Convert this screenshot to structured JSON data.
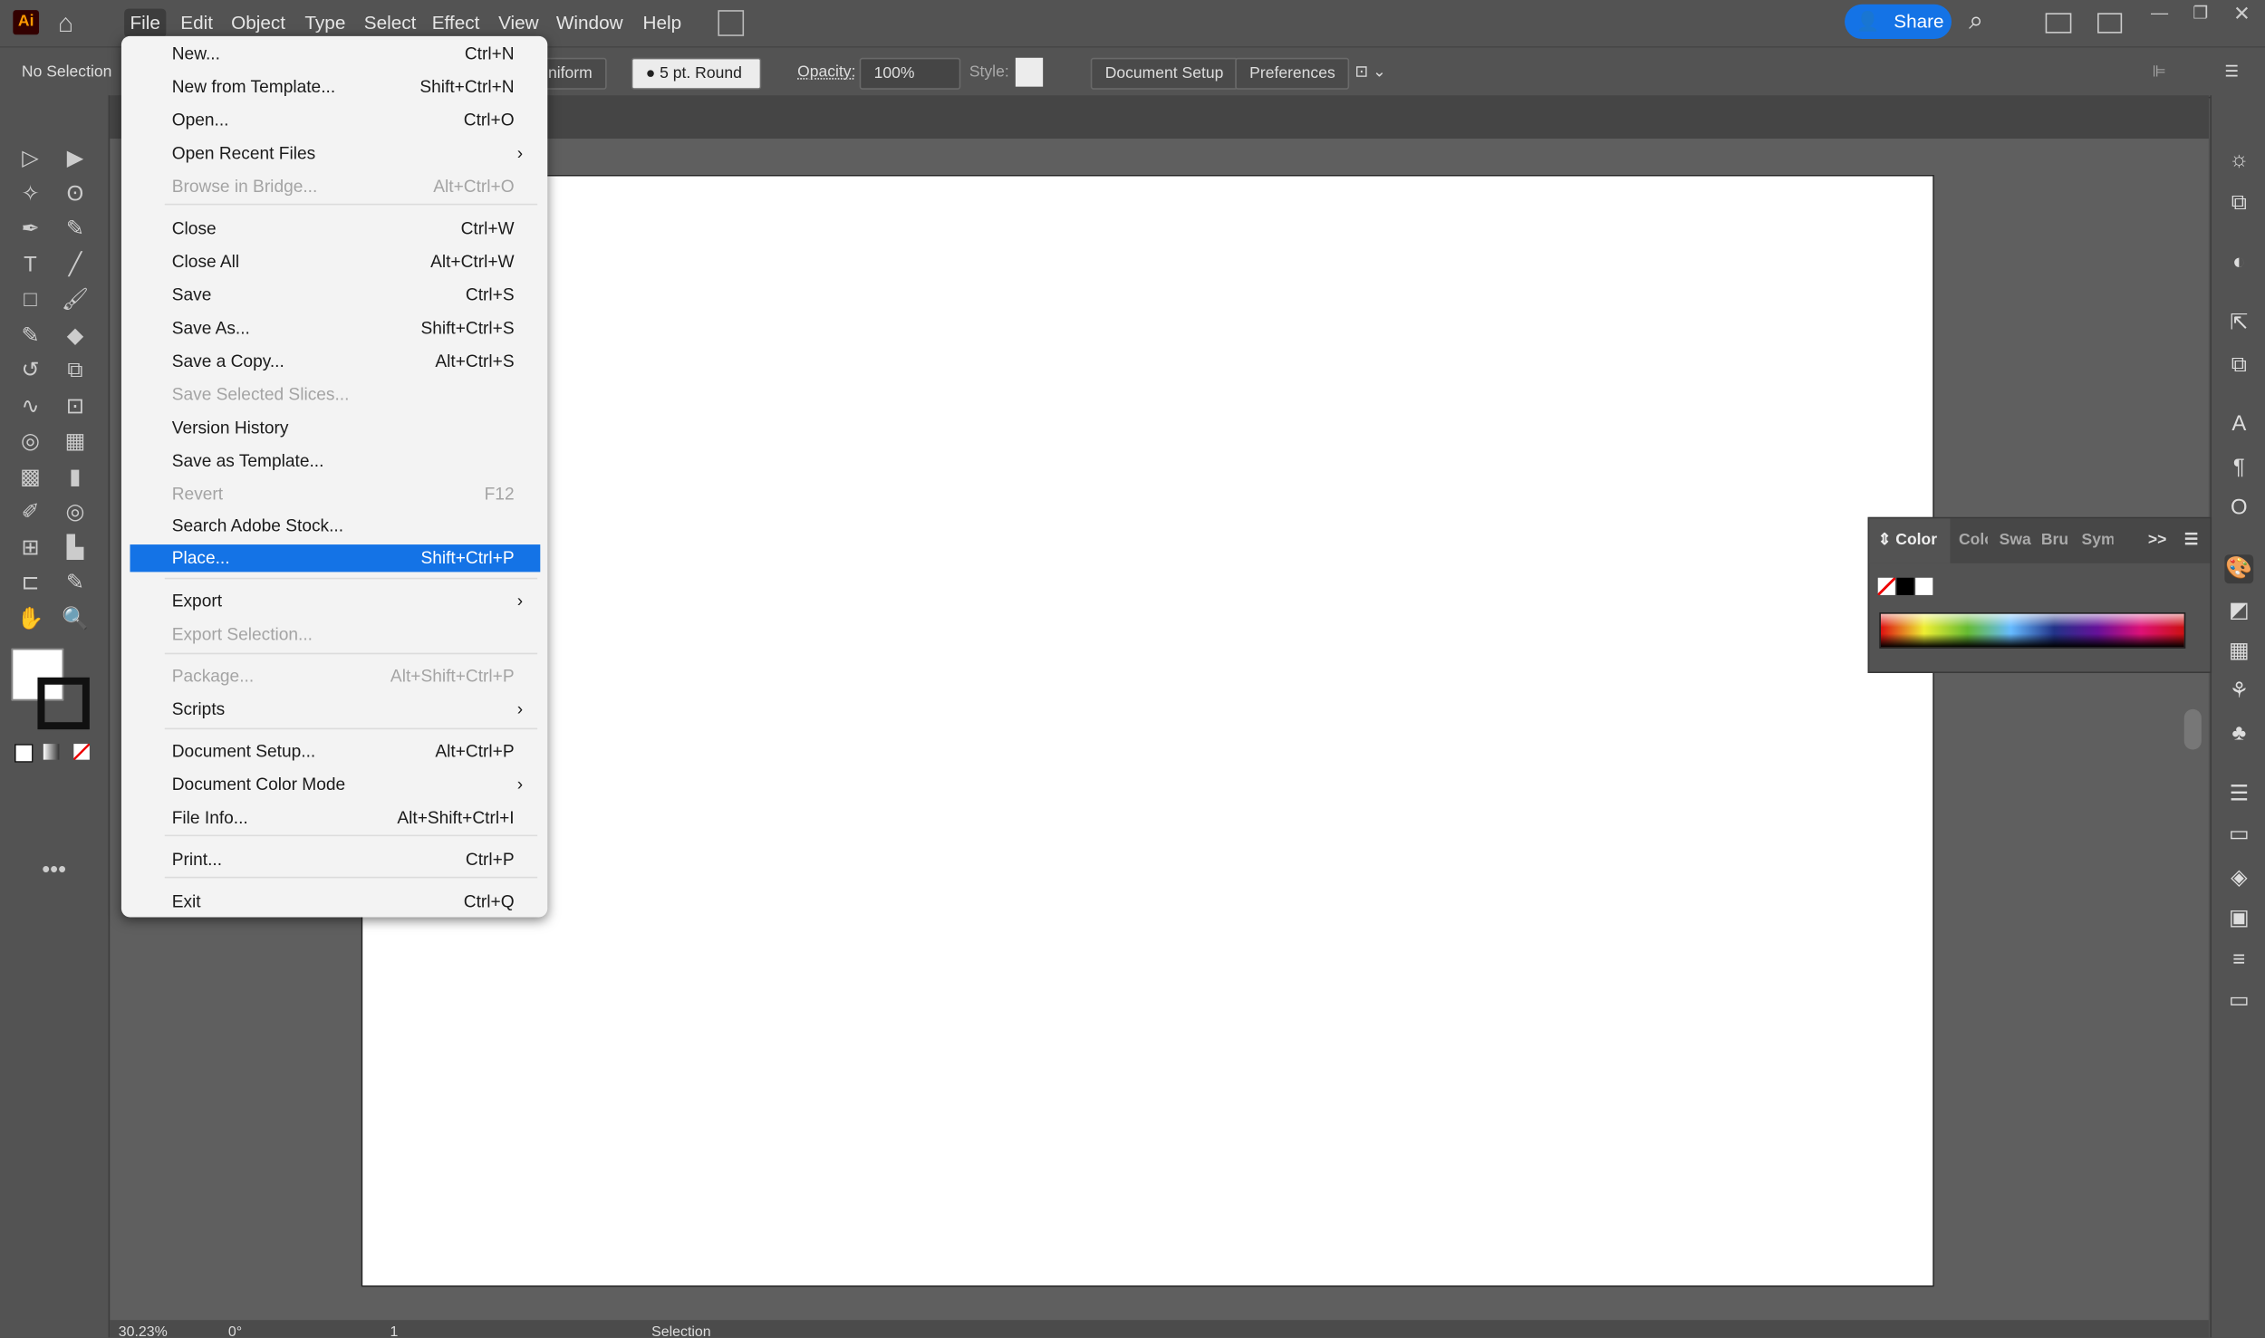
{
  "app": {
    "logo": "Ai",
    "share_label": "Share"
  },
  "menubar": [
    "File",
    "Edit",
    "Object",
    "Type",
    "Select",
    "Effect",
    "View",
    "Window",
    "Help"
  ],
  "control_bar": {
    "selection": "No Selection",
    "stroke_profile": "Uniform",
    "brush": "5 pt. Round",
    "opacity_label": "Opacity:",
    "opacity": "100%",
    "style_label": "Style:",
    "document_setup": "Document Setup",
    "preferences": "Preferences"
  },
  "file_menu": [
    {
      "label": "New...",
      "shortcut": "Ctrl+N"
    },
    {
      "label": "New from Template...",
      "shortcut": "Shift+Ctrl+N"
    },
    {
      "label": "Open...",
      "shortcut": "Ctrl+O"
    },
    {
      "label": "Open Recent Files",
      "submenu": true
    },
    {
      "label": "Browse in Bridge...",
      "shortcut": "Alt+Ctrl+O",
      "disabled": true
    },
    {
      "label": "Close",
      "shortcut": "Ctrl+W"
    },
    {
      "label": "Close All",
      "shortcut": "Alt+Ctrl+W"
    },
    {
      "label": "Save",
      "shortcut": "Ctrl+S"
    },
    {
      "label": "Save As...",
      "shortcut": "Shift+Ctrl+S"
    },
    {
      "label": "Save a Copy...",
      "shortcut": "Alt+Ctrl+S"
    },
    {
      "label": "Save Selected Slices...",
      "disabled": true
    },
    {
      "label": "Version History"
    },
    {
      "label": "Save as Template..."
    },
    {
      "label": "Revert",
      "shortcut": "F12",
      "disabled": true
    },
    {
      "label": "Search Adobe Stock..."
    },
    {
      "label": "Place...",
      "shortcut": "Shift+Ctrl+P",
      "selected": true
    },
    {
      "label": "Export",
      "submenu": true
    },
    {
      "label": "Export Selection...",
      "disabled": true
    },
    {
      "label": "Package...",
      "shortcut": "Alt+Shift+Ctrl+P",
      "disabled": true
    },
    {
      "label": "Scripts",
      "submenu": true
    },
    {
      "label": "Document Setup...",
      "shortcut": "Alt+Ctrl+P"
    },
    {
      "label": "Document Color Mode",
      "submenu": true
    },
    {
      "label": "File Info...",
      "shortcut": "Alt+Shift+Ctrl+I"
    },
    {
      "label": "Print...",
      "shortcut": "Ctrl+P"
    },
    {
      "label": "Exit",
      "shortcut": "Ctrl+Q"
    }
  ],
  "color_panel": {
    "tabs": [
      "Color",
      "Colo",
      "Swa",
      "Brus",
      "Syml"
    ]
  },
  "status_bar": {
    "zoom": "30.23%",
    "rotation": "0°",
    "artboard": "1",
    "tool": "Selection"
  },
  "colors": {
    "accent": "#1473e6",
    "background": "#535353",
    "canvas": "#5f5f5f"
  }
}
